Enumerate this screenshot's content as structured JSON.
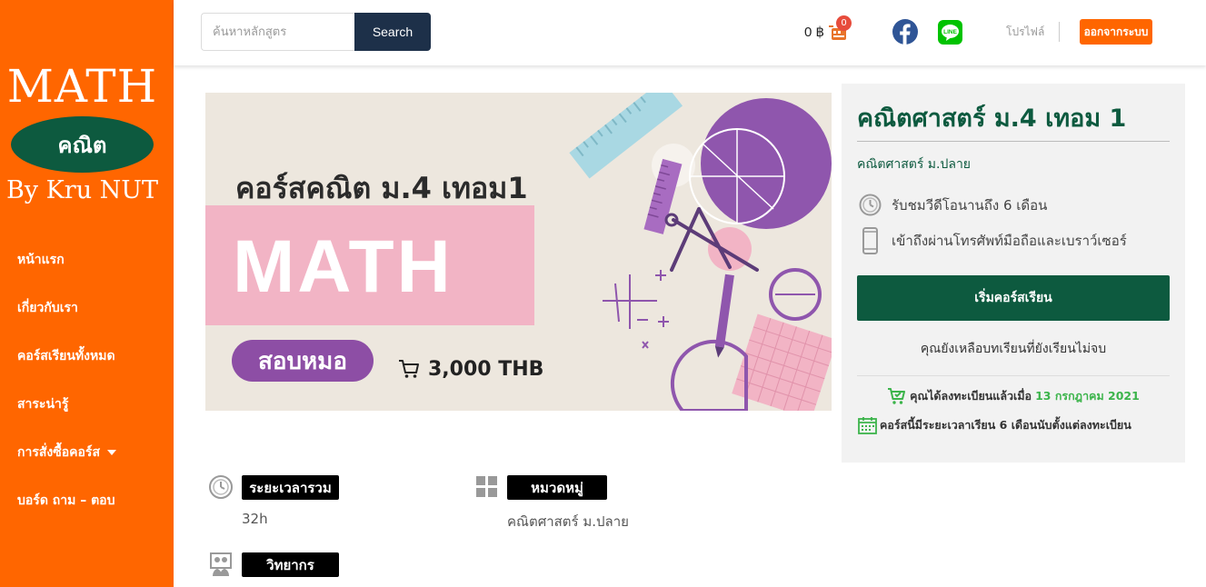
{
  "sidebar": {
    "logo": {
      "line1": "MATH",
      "oval": "คณิต",
      "line3": "By Kru NUT"
    },
    "items": [
      {
        "label": "หน้าแรก"
      },
      {
        "label": "เกี่ยวกับเรา"
      },
      {
        "label": "คอร์สเรียนทั้งหมด"
      },
      {
        "label": "สาระน่ารู้"
      },
      {
        "label": "การสั่งซื้อคอร์ส"
      },
      {
        "label": "บอร์ด ถาม – ตอบ"
      }
    ],
    "colors": {
      "background": "#ff6600",
      "logo_oval": "#0d5a3f"
    }
  },
  "header": {
    "search": {
      "placeholder": "ค้นหาหลักสูตร",
      "button": "Search"
    },
    "cart": {
      "amount": "0 ฿",
      "badge": "0",
      "icon": "cart-icon"
    },
    "social": {
      "facebook": "facebook-icon",
      "line": "line-icon"
    },
    "profile": "โปรไฟล์",
    "logout": "ออกจากระบบ"
  },
  "banner": {
    "title": "คอร์สคณิต ม.4 เทอม1",
    "big_text": "MATH",
    "pill": "สอบหมอ",
    "price": "3,000 THB"
  },
  "course": {
    "title": "คณิตศาสตร์ ม.4 เทอม 1",
    "category": "คณิตศาสตร์ ม.ปลาย",
    "features": [
      {
        "icon": "clock-icon",
        "text": "รับชมวีดีโอนานถึง 6 เดือน"
      },
      {
        "icon": "phone-icon",
        "text": "เข้าถึงผ่านโทรศัพท์มือถือและเบราว์เซอร์"
      }
    ],
    "start_button": "เริ่มคอร์สเรียน",
    "remaining_text": "คุณยังเหลือบทเรียนที่ยังเรียนไม่จบ",
    "registered_prefix": "คุณได้ลงทะเบียนแล้วเมื่อ",
    "registered_date": "13 กรกฎาคม 2021",
    "duration_note": "คอร์สนี้มีระยะเวลาเรียน 6 เดือนนับตั้งแต่ลงทะเบียน",
    "colors": {
      "primary": "#0d5a3f",
      "accent_green": "#3cb44b"
    }
  },
  "meta": {
    "duration": {
      "label": "ระยะเวลารวม",
      "value": "32h"
    },
    "category": {
      "label": "หมวดหมู่",
      "value": "คณิตศาสตร์ ม.ปลาย"
    },
    "instructor": {
      "label": "วิทยากร"
    }
  }
}
